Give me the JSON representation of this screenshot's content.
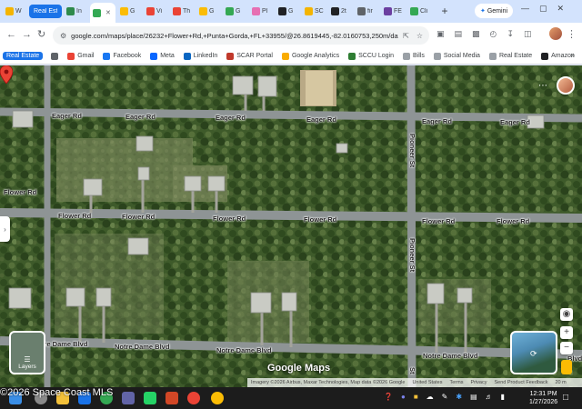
{
  "browser": {
    "tabs": [
      {
        "label": "W",
        "color": "#f4b400"
      },
      {
        "label": "Real Estate",
        "color": "#1a73e8",
        "chip": true
      },
      {
        "label": "In",
        "color": "#2e8a4b"
      },
      {
        "label": "",
        "color": "#34a853",
        "active": true
      },
      {
        "label": "G",
        "color": "#fbbc04"
      },
      {
        "label": "Vi",
        "color": "#ea4335"
      },
      {
        "label": "Th",
        "color": "#ea4335"
      },
      {
        "label": "G",
        "color": "#fbbc04"
      },
      {
        "label": "G",
        "color": "#34a853"
      },
      {
        "label": "Pl",
        "color": "#e66fb3"
      },
      {
        "label": "G",
        "color": "#202124"
      },
      {
        "label": "SC",
        "color": "#f4b400"
      },
      {
        "label": "2t",
        "color": "#202124"
      },
      {
        "label": "fir",
        "color": "#5f6368"
      },
      {
        "label": "FE",
        "color": "#6b3fa0"
      },
      {
        "label": "Cli",
        "color": "#34a853"
      }
    ],
    "new_tab": "+",
    "gemini_label": "Gemini",
    "window_controls": {
      "minimize": "—",
      "maximize": "▢",
      "close": "✕"
    },
    "url": "google.com/maps/place/26232+Flower+Rd,+Punta+Gorda,+FL+33955/@26.8619445,-82.0160753,250m/data=!3..."
  },
  "bookmarks": [
    {
      "label": "Real Estate",
      "chip": true
    },
    {
      "label": "",
      "icon": "apps-icon",
      "color": "#5f6368"
    },
    {
      "label": "Gmail",
      "color": "#ea4335"
    },
    {
      "label": "Facebook",
      "color": "#1877f2"
    },
    {
      "label": "Meta",
      "color": "#0866ff"
    },
    {
      "label": "LinkedIn",
      "color": "#0a66c2"
    },
    {
      "label": "SCAR Portal",
      "color": "#c0392b"
    },
    {
      "label": "Google Analytics",
      "color": "#f9ab00"
    },
    {
      "label": "SCCU Login",
      "color": "#2e7d32"
    },
    {
      "label": "Bills",
      "color": "#9aa0a6"
    },
    {
      "label": "Social Media",
      "color": "#9aa0a6"
    },
    {
      "label": "Real Estate",
      "color": "#9aa0a6"
    },
    {
      "label": "Amazon",
      "color": "#202124"
    }
  ],
  "bookmarks_more": "»",
  "map": {
    "roads": {
      "eager": [
        "Eager Rd",
        "Eager Rd",
        "Eager Rd",
        "Eager Rd",
        "Eager Rd",
        "Eager Rd"
      ],
      "flower": [
        "Flower Rd",
        "Flower Rd",
        "Flower Rd",
        "Flower Rd",
        "Flower Rd",
        "Flower Rd"
      ],
      "notre_dame": [
        "Notre Dame Blvd",
        "Notre Dame Blvd",
        "Notre Dame Blvd",
        "Notre Dame Blvd",
        "Blvd"
      ],
      "pioneer": [
        "Pioneer St",
        "Pioneer St",
        "St"
      ]
    },
    "layers_label": "Layers",
    "logo": "Google Maps",
    "attribution": [
      "Imagery ©2026 Airbus, Maxar Technologies, Map data ©2026 Google",
      "United States",
      "Terms",
      "Privacy",
      "Send Product Feedback",
      "20 m"
    ],
    "zoom_in": "+",
    "zoom_out": "−"
  },
  "watermark": "©2026 Space Coast MLS",
  "taskbar": {
    "apps": [
      {
        "name": "windows-start-icon",
        "color": "#3a8ee6"
      },
      {
        "name": "search-icon",
        "color": "#8a8a8a"
      },
      {
        "name": "file-explorer-icon",
        "color": "#f3c13a"
      },
      {
        "name": "outlook-icon",
        "color": "#1a73e8"
      },
      {
        "name": "chrome-icon",
        "color": "#34a853"
      },
      {
        "name": "teams-icon",
        "color": "#6264a7"
      },
      {
        "name": "whatsapp-icon",
        "color": "#25d366"
      },
      {
        "name": "powerpoint-icon",
        "color": "#d24726"
      },
      {
        "name": "chrome-icon-2",
        "color": "#ea4335"
      },
      {
        "name": "chrome-icon-3",
        "color": "#fbbc04"
      }
    ],
    "time": "12:31 PM",
    "date": "1/27/2026"
  }
}
